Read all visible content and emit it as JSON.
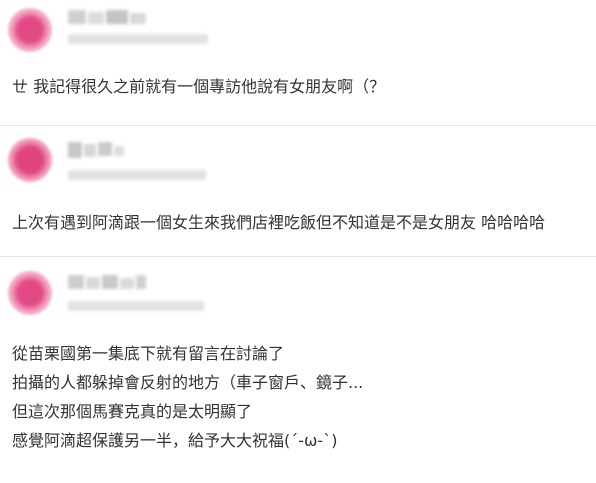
{
  "colors": {
    "avatar_pink": "#e24a86",
    "avatar_light": "#f6b6cf",
    "blur_gray": "#c8c8c8",
    "text": "#333333",
    "divider": "#e6e6e6"
  },
  "comments": [
    {
      "lines": [
        "ㄝ 我記得很久之前就有一個專訪他說有女朋友啊（？"
      ]
    },
    {
      "lines": [
        "上次有遇到阿滴跟一個女生來我們店裡吃飯但不知道是不是女朋友 哈哈哈哈"
      ]
    },
    {
      "lines": [
        "從苗栗國第一集底下就有留言在討論了",
        "拍攝的人都躲掉會反射的地方（車子窗戶、鏡子...",
        "但這次那個馬賽克真的是太明顯了",
        "感覺阿滴超保護另一半，給予大大祝福(´-ω-`)"
      ]
    }
  ]
}
